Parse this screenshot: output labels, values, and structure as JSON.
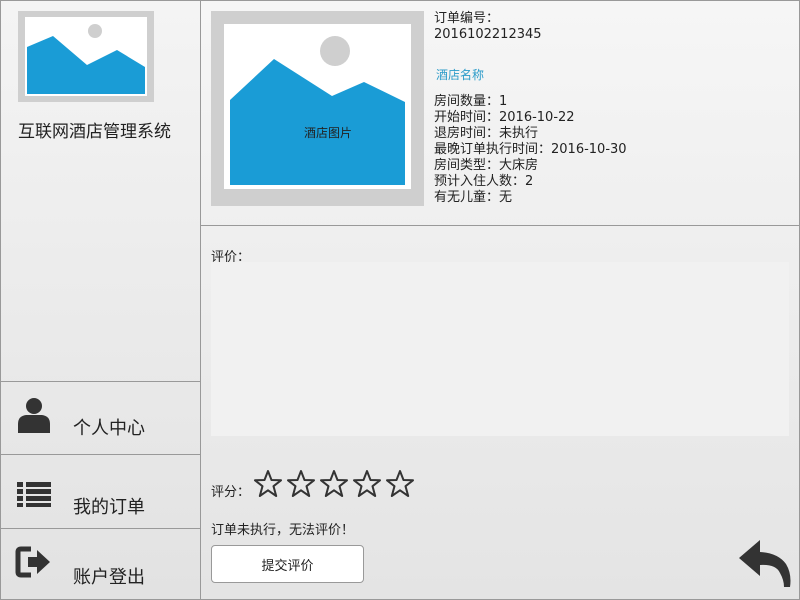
{
  "app": {
    "title": "互联网酒店管理系统"
  },
  "sidebar": {
    "items": [
      {
        "label": "个人中心",
        "icon": "user-icon"
      },
      {
        "label": "我的订单",
        "icon": "list-icon"
      },
      {
        "label": "账户登出",
        "icon": "logout-icon"
      }
    ]
  },
  "order": {
    "number_label": "订单编号：",
    "number_value": "2016102212345",
    "hotel_name": "酒店名称",
    "image_label": "酒店图片",
    "details": [
      "房间数量：1",
      "开始时间：2016-10-22",
      "退房时间：未执行",
      "最晚订单执行时间：2016-10-30",
      "房间类型：大床房",
      "预计入住人数：2",
      "有无儿童：无"
    ]
  },
  "review": {
    "label": "评价：",
    "text": "",
    "rating_label": "评分：",
    "rating_value": 0,
    "rating_max": 5,
    "status_message": "订单未执行，无法评价！",
    "submit_label": "提交评价",
    "back_icon": "back-arrow-icon"
  },
  "colors": {
    "image_blue": "#1a9cd6",
    "image_frame": "#cfcfcf",
    "hotel_name_link": "#2b9bc9",
    "icon_dark": "#333333"
  }
}
